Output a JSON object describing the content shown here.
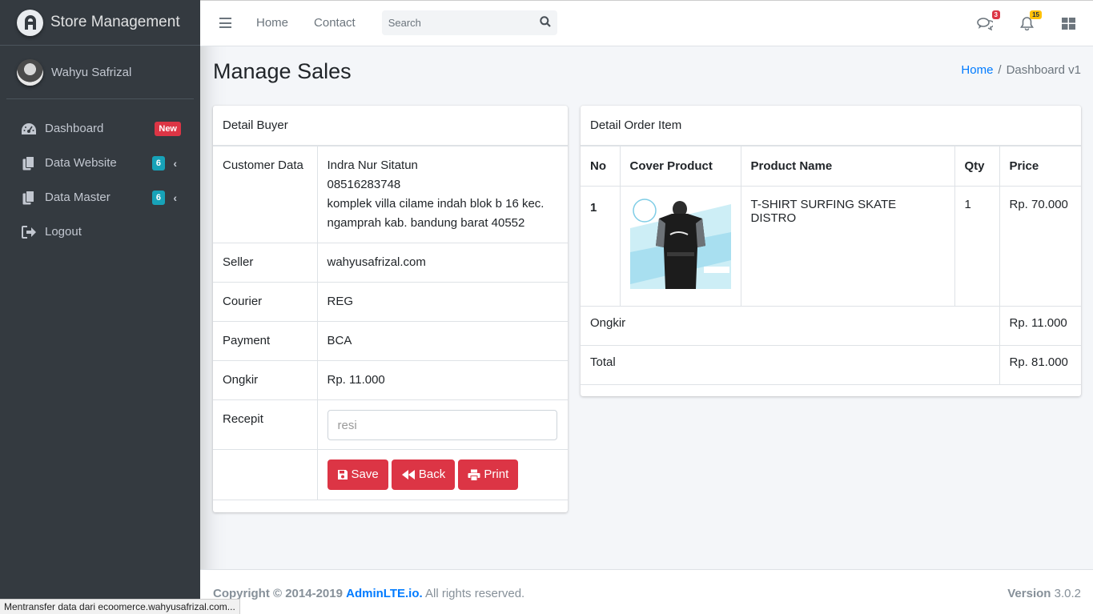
{
  "brand": {
    "name": "Store Management"
  },
  "user": {
    "name": "Wahyu Safrizal"
  },
  "sidebar": {
    "items": [
      {
        "label": "Dashboard",
        "badge": "New"
      },
      {
        "label": "Data Website",
        "badge": "6"
      },
      {
        "label": "Data Master",
        "badge": "6"
      },
      {
        "label": "Logout"
      }
    ]
  },
  "topbar": {
    "links": [
      "Home",
      "Contact"
    ],
    "search_placeholder": "Search",
    "messages_count": "3",
    "notifications_count": "15"
  },
  "page": {
    "title": "Manage Sales",
    "breadcrumb": [
      "Home",
      "Dashboard v1"
    ]
  },
  "buyer": {
    "header": "Detail Buyer",
    "customer_label": "Customer Data",
    "customer_name": "Indra Nur Sitatun",
    "customer_phone": "08516283748",
    "customer_address": "komplek villa cilame indah blok b 16 kec. ngamprah kab. bandung barat 40552",
    "seller_label": "Seller",
    "seller": "wahyusafrizal.com",
    "courier_label": "Courier",
    "courier": "REG",
    "payment_label": "Payment",
    "payment": "BCA",
    "ongkir_label": "Ongkir",
    "ongkir": "Rp. 11.000",
    "receipt_label": "Recepit",
    "receipt_placeholder": "resi",
    "buttons": {
      "save": "Save",
      "back": "Back",
      "print": "Print"
    }
  },
  "order": {
    "header": "Detail Order Item",
    "columns": [
      "No",
      "Cover Product",
      "Product Name",
      "Qty",
      "Price"
    ],
    "rows": [
      {
        "no": "1",
        "product_name": "T-SHIRT SURFING SKATE DISTRO",
        "qty": "1",
        "price": "Rp. 70.000"
      }
    ],
    "ongkir_label": "Ongkir",
    "ongkir": "Rp. 11.000",
    "total_label": "Total",
    "total": "Rp. 81.000"
  },
  "footer": {
    "copyright": "Copyright © 2014-2019",
    "link": "AdminLTE.io.",
    "rights": "All rights reserved.",
    "version_label": "Version",
    "version": "3.0.2"
  },
  "statusbar": {
    "text": "Mentransfer data dari ecoomerce.wahyusafrizal.com..."
  },
  "colors": {
    "sidebar": "#343a40",
    "danger": "#dc3545",
    "info": "#17a2b8",
    "primary": "#007bff",
    "warning": "#ffc107"
  }
}
